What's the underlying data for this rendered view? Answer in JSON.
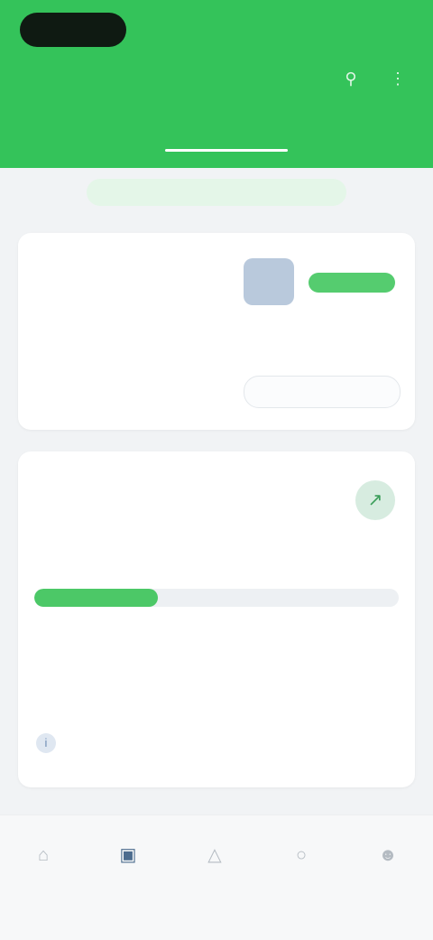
{
  "header": {
    "logo_text": "",
    "top_link": "",
    "title": "",
    "icons": [
      "search-icon",
      "more-icon"
    ],
    "tabs": [
      {
        "label": "",
        "active": false
      },
      {
        "label": "",
        "active": true
      },
      {
        "label": "",
        "active": false
      }
    ],
    "colors": {
      "primary": "#34c35a"
    }
  },
  "banner": {
    "text": ""
  },
  "balance": {
    "small_label": "",
    "caption": "",
    "amount": "",
    "asset_badge": "",
    "asset_name": "",
    "view_button": ""
  },
  "portfolio": {
    "label": "",
    "sub": "",
    "amount": "",
    "progress": 0.34,
    "progress_left_label": "",
    "progress_right_label": "",
    "row_label": "",
    "row_value": "",
    "info_text": "",
    "link_text": ""
  },
  "bottom_nav": {
    "items": [
      {
        "label": "",
        "icon": "home-icon",
        "active": false
      },
      {
        "label": "",
        "icon": "wallet-icon",
        "active": true
      },
      {
        "label": "",
        "icon": "chart-icon",
        "active": false
      },
      {
        "label": "",
        "icon": "bell-icon",
        "active": false
      },
      {
        "label": "",
        "icon": "profile-icon",
        "active": false
      }
    ]
  }
}
